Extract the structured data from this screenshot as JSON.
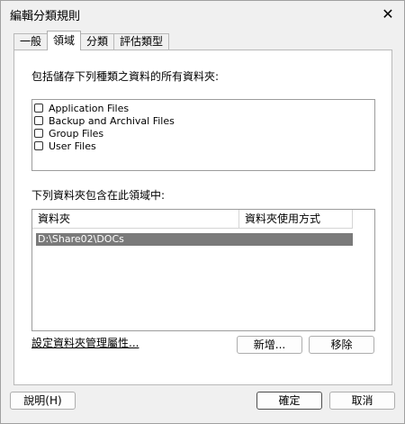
{
  "window": {
    "title": "編輯分類規則"
  },
  "tabs": [
    {
      "label": "一般"
    },
    {
      "label": "領域"
    },
    {
      "label": "分類"
    },
    {
      "label": "評估類型"
    }
  ],
  "scope": {
    "types_label": "包括儲存下列種類之資料的所有資料夾:",
    "types": [
      {
        "label": "Application Files",
        "checked": false
      },
      {
        "label": "Backup and Archival Files",
        "checked": false
      },
      {
        "label": "Group Files",
        "checked": false
      },
      {
        "label": "User Files",
        "checked": false
      }
    ],
    "folders_label": "下列資料夾包含在此領域中:",
    "table": {
      "headers": [
        "資料夾",
        "資料夾使用方式"
      ],
      "rows": [
        {
          "folder": "D:\\Share02\\DOCs",
          "usage": ""
        }
      ]
    },
    "manage_link": "設定資料夾管理屬性...",
    "add_button": "新增...",
    "remove_button": "移除"
  },
  "footer": {
    "help_button": "說明(H)",
    "ok_button": "確定",
    "cancel_button": "取消"
  }
}
